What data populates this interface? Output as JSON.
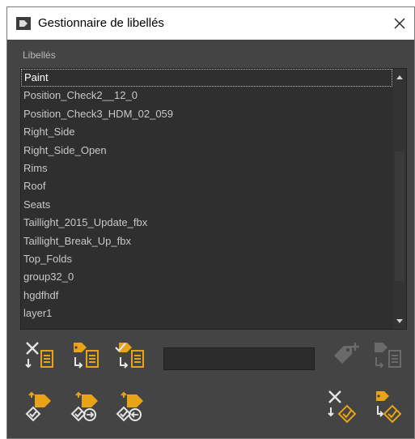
{
  "window": {
    "title": "Gestionnaire de libellés",
    "close_glyph": "✕"
  },
  "section_label": "Libellés",
  "labels": [
    {
      "label": "Paint",
      "selected": true
    },
    {
      "label": "Position_Check2__12_0",
      "selected": false
    },
    {
      "label": "Position_Check3_HDM_02_059",
      "selected": false
    },
    {
      "label": "Right_Side",
      "selected": false
    },
    {
      "label": "Right_Side_Open",
      "selected": false
    },
    {
      "label": "Rims",
      "selected": false
    },
    {
      "label": "Roof",
      "selected": false
    },
    {
      "label": "Seats",
      "selected": false
    },
    {
      "label": "Taillight_2015_Update_fbx",
      "selected": false
    },
    {
      "label": "Taillight_Break_Up_fbx",
      "selected": false
    },
    {
      "label": "Top_Folds",
      "selected": false
    },
    {
      "label": "group32_0",
      "selected": false
    },
    {
      "label": "hgdfhdf",
      "selected": false
    },
    {
      "label": "layer1",
      "selected": false
    }
  ],
  "icons": {
    "remove_from_list": "remove-label-list-icon",
    "assign_list": "assign-label-list-icon",
    "select_list": "select-label-list-icon",
    "add_label": "add-label-icon",
    "label_list_disabled": "label-list-disabled-icon",
    "select_objects": "select-objects-icon",
    "add_selection": "add-selection-icon",
    "subtract_selection": "subtract-selection-icon",
    "remove_label_objects": "remove-label-objects-icon",
    "assign_objects": "assign-objects-icon"
  },
  "colors": {
    "accent": "#e8a317",
    "icon_light": "#e6e6e6",
    "disabled": "#6a6a6a",
    "panel": "#444444",
    "list_bg": "#2f2f2f"
  }
}
